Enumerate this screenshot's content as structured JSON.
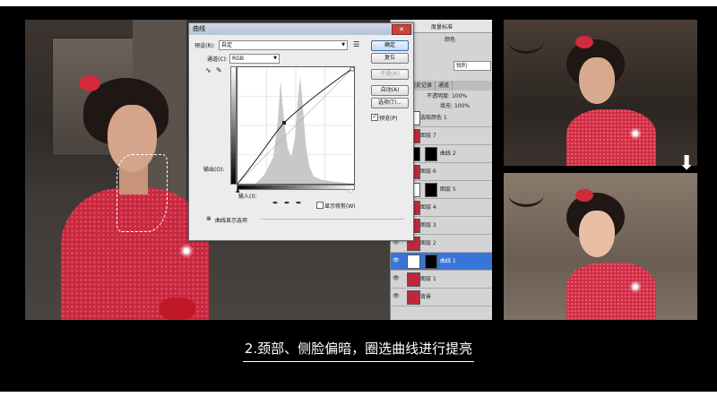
{
  "caption": "2.颈部、侧脸偏暗，圈选曲线进行提亮",
  "dialog": {
    "title": "曲线",
    "close": "✕",
    "preset_label": "预设(R):",
    "preset_value": "自定",
    "channel_label": "通道(C):",
    "channel_value": "RGB",
    "output_label": "输出(O):",
    "input_label": "输入(I):",
    "show_clipping": "显示修剪(W)",
    "display_options": "曲线显示选项",
    "buttons": {
      "ok": "确定",
      "reset": "复位",
      "smooth": "平滑(M)",
      "auto": "自动(A)",
      "options": "选项(T)...",
      "preview": "预览(P)"
    },
    "preview_checked": true,
    "show_clipping_checked": false
  },
  "ps_panel": {
    "toolbar_text": "度量标准",
    "dropdown_1": "颜色",
    "dropdown_2": "锐利",
    "opacity_label": "不透明度:",
    "opacity_value": "100%",
    "fill_label": "填充:",
    "fill_value": "100%",
    "tabs": [
      "路径",
      "历史记录",
      "通道"
    ],
    "layers": [
      {
        "name": "选取颜色 1",
        "thumb": "white",
        "mask": "",
        "active": false
      },
      {
        "name": "图层 7",
        "thumb": "",
        "mask": "",
        "active": false
      },
      {
        "name": "曲线 2",
        "thumb": "black",
        "mask": "black",
        "active": false
      },
      {
        "name": "图层 6",
        "thumb": "",
        "mask": "",
        "active": false
      },
      {
        "name": "图层 5",
        "thumb": "white",
        "mask": "black",
        "active": false
      },
      {
        "name": "图层 4",
        "thumb": "",
        "mask": "",
        "active": false
      },
      {
        "name": "图层 3",
        "thumb": "",
        "mask": "",
        "active": false
      },
      {
        "name": "图层 2",
        "thumb": "",
        "mask": "",
        "active": false
      },
      {
        "name": "曲线 1",
        "thumb": "white",
        "mask": "black",
        "active": true
      },
      {
        "name": "图层 1",
        "thumb": "",
        "mask": "",
        "active": false
      },
      {
        "name": "背景",
        "thumb": "",
        "mask": "",
        "active": false
      }
    ]
  },
  "colors": {
    "background": "#000000",
    "dress": "#c7283e",
    "selected_layer": "#3875d7"
  },
  "arrow_icon": "arrow-down-icon"
}
